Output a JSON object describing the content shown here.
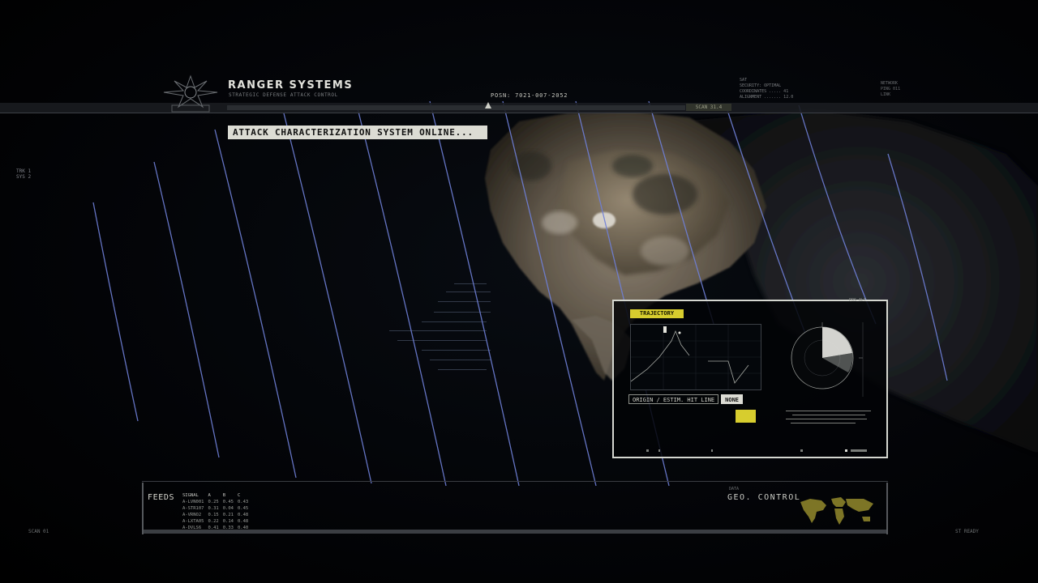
{
  "header": {
    "brand_title": "RANGER SYSTEMS",
    "brand_subtitle": "STRATEGIC DEFENSE ATTACK CONTROL",
    "status_banner": "ATTACK CHARACTERIZATION SYSTEM ONLINE...",
    "frame_code": "POSN: 7021-007-2052",
    "header_tag": "SCAN 31.4",
    "readout_lines": [
      "SAT",
      "SECURITY: OPTIMAL",
      "COORDINATES .....  41",
      "ALIGNMENT .......  12.0"
    ],
    "readout_lines_right": [
      "NETWORK",
      "PING 011",
      "LINK"
    ]
  },
  "left_side": {
    "lines": [
      "TRK 1",
      "SYS 2"
    ]
  },
  "panel": {
    "tag_label": "TRAJECTORY",
    "tabs": [
      {
        "label": "ORIGIN / ESTIM. HIT LINE",
        "active": false
      },
      {
        "label": "NONE",
        "active": true
      }
    ],
    "corner_readout": "POS ALT"
  },
  "feeds": {
    "label": "FEEDS",
    "columns": [
      "SIGNAL",
      "A",
      "B",
      "C"
    ],
    "rows": [
      [
        "A-LVN001",
        "0.25",
        "0.45",
        "0.43"
      ],
      [
        "A-STR107",
        "0.31",
        "0.04",
        "0.45"
      ],
      [
        "A-VRNO2",
        "0.15",
        "0.21",
        "0.48"
      ],
      [
        "A-LXTA05",
        "0.22",
        "0.14",
        "0.48"
      ],
      [
        "A-DVLS6",
        "0.41",
        "0.33",
        "0.40"
      ]
    ]
  },
  "geo": {
    "label": "GEO. CONTROL",
    "sub": "DATA"
  },
  "footer": {
    "left_code": "SCAN  01",
    "right_code": "ST  READY"
  },
  "colors": {
    "accent_yellow": "#d7cd2e",
    "scan_line_blue": "#6f80d8",
    "panel_border": "#d5d7d0"
  },
  "icons": [
    "ranger-emblem-icon",
    "radar-scope-icon",
    "world-map-icon"
  ]
}
